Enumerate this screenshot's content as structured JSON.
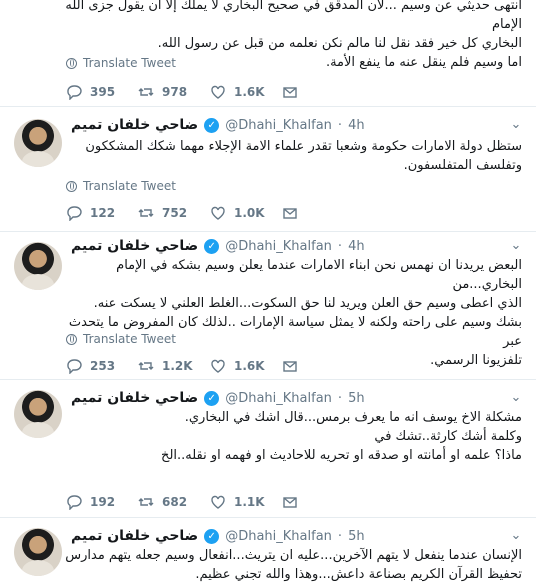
{
  "translate_label": "Translate Tweet",
  "tweets": [
    {
      "lines": [
        "انتهى حديثي عن وسيم ...لأن المدقق في صحيح البخاري لا يملك إلا أن يقول جزى الله الإمام",
        "البخاري كل خير فقد نقل لنا مالم نكن نعلمه من قبل عن رسول الله.",
        "اما وسيم فلم ينقل عنه ما ينفع الأمة."
      ],
      "replies": "395",
      "retweets": "978",
      "likes": "1.6K"
    },
    {
      "name": "ضاحي خلفان تميم",
      "handle": "@Dhahi_Khalfan",
      "time": "4h",
      "lines": [
        "ستظل دولة الامارات حكومة وشعبا تقدر علماء الامة الإجلاء مهما شكك المشككون",
        "وتفلسف المتفلسفون."
      ],
      "replies": "122",
      "retweets": "752",
      "likes": "1.0K"
    },
    {
      "name": "ضاحي خلفان تميم",
      "handle": "@Dhahi_Khalfan",
      "time": "4h",
      "lines": [
        "البعض يريدنا ان نهمس نحن ابناء الامارات عندما يعلن وسيم بشكه في الإمام البخاري...من",
        "الذي اعطى وسيم حق العلن ويريد لنا حق السكوت...الغلط العلني لا يسكت عنه.",
        "بشك  وسيم على راحته ولكنه لا يمثل سياسة الإمارات ..لذلك كان المفروض ما يتحدث عبر",
        "تلفزيونا الرسمي."
      ],
      "replies": "253",
      "retweets": "1.2K",
      "likes": "1.6K"
    },
    {
      "name": "ضاحي خلفان تميم",
      "handle": "@Dhahi_Khalfan",
      "time": "5h",
      "lines": [
        "مشكلة الاخ يوسف انه ما يعرف برمس...قال اشك في البخاري.",
        "وكلمة أشك كارثة..تشك في",
        "ماذا؟ علمه او أمانته او صدقه او تحريه للاحاديث او فهمه او نقله..الخ"
      ],
      "replies": "192",
      "retweets": "682",
      "likes": "1.1K"
    },
    {
      "name": "ضاحي خلفان تميم",
      "handle": "@Dhahi_Khalfan",
      "time": "5h",
      "lines": [
        "الإنسان عندما ينفعل لا يتهم الآخرين...عليه ان يتريث...انفعال  وسيم جعله يتهم مدارس",
        "تحفيظ القرآن الكريم بصناعة داعش...وهذا والله تجني عظيم."
      ]
    }
  ]
}
